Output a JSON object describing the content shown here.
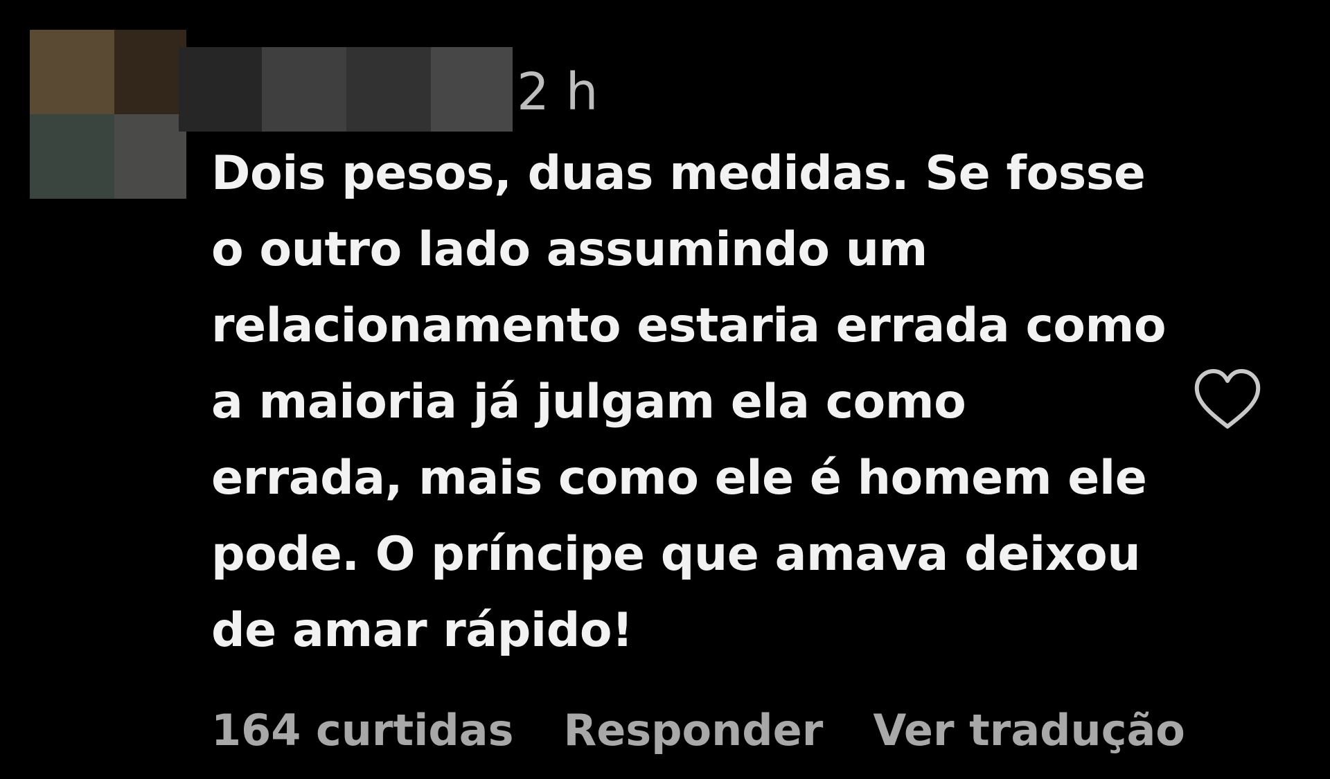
{
  "avatar": {
    "mosaic_colors": [
      "#5a4a34",
      "#33271c",
      "#3b4540",
      "#4a4a48"
    ]
  },
  "username": {
    "mosaic_colors": [
      "#262626",
      "#3f3f3f",
      "#323232",
      "#474747"
    ]
  },
  "timestamp": "2 h",
  "comment_lines": [
    "Dois pesos, duas medidas. Se fosse",
    "o outro lado assumindo um",
    "relacionamento estaria errada como",
    "a maioria já julgam ela como",
    "errada, mais como ele é homem ele",
    "pode. O príncipe que amava deixou",
    "de amar rápido!"
  ],
  "actions": {
    "likes_label": "164 curtidas",
    "reply_label": "Responder",
    "translate_label": "Ver tradução"
  },
  "icons": {
    "like": "heart-icon"
  },
  "colors": {
    "background": "#000000",
    "text": "#f2f2f2",
    "muted": "#a8a8a8"
  }
}
